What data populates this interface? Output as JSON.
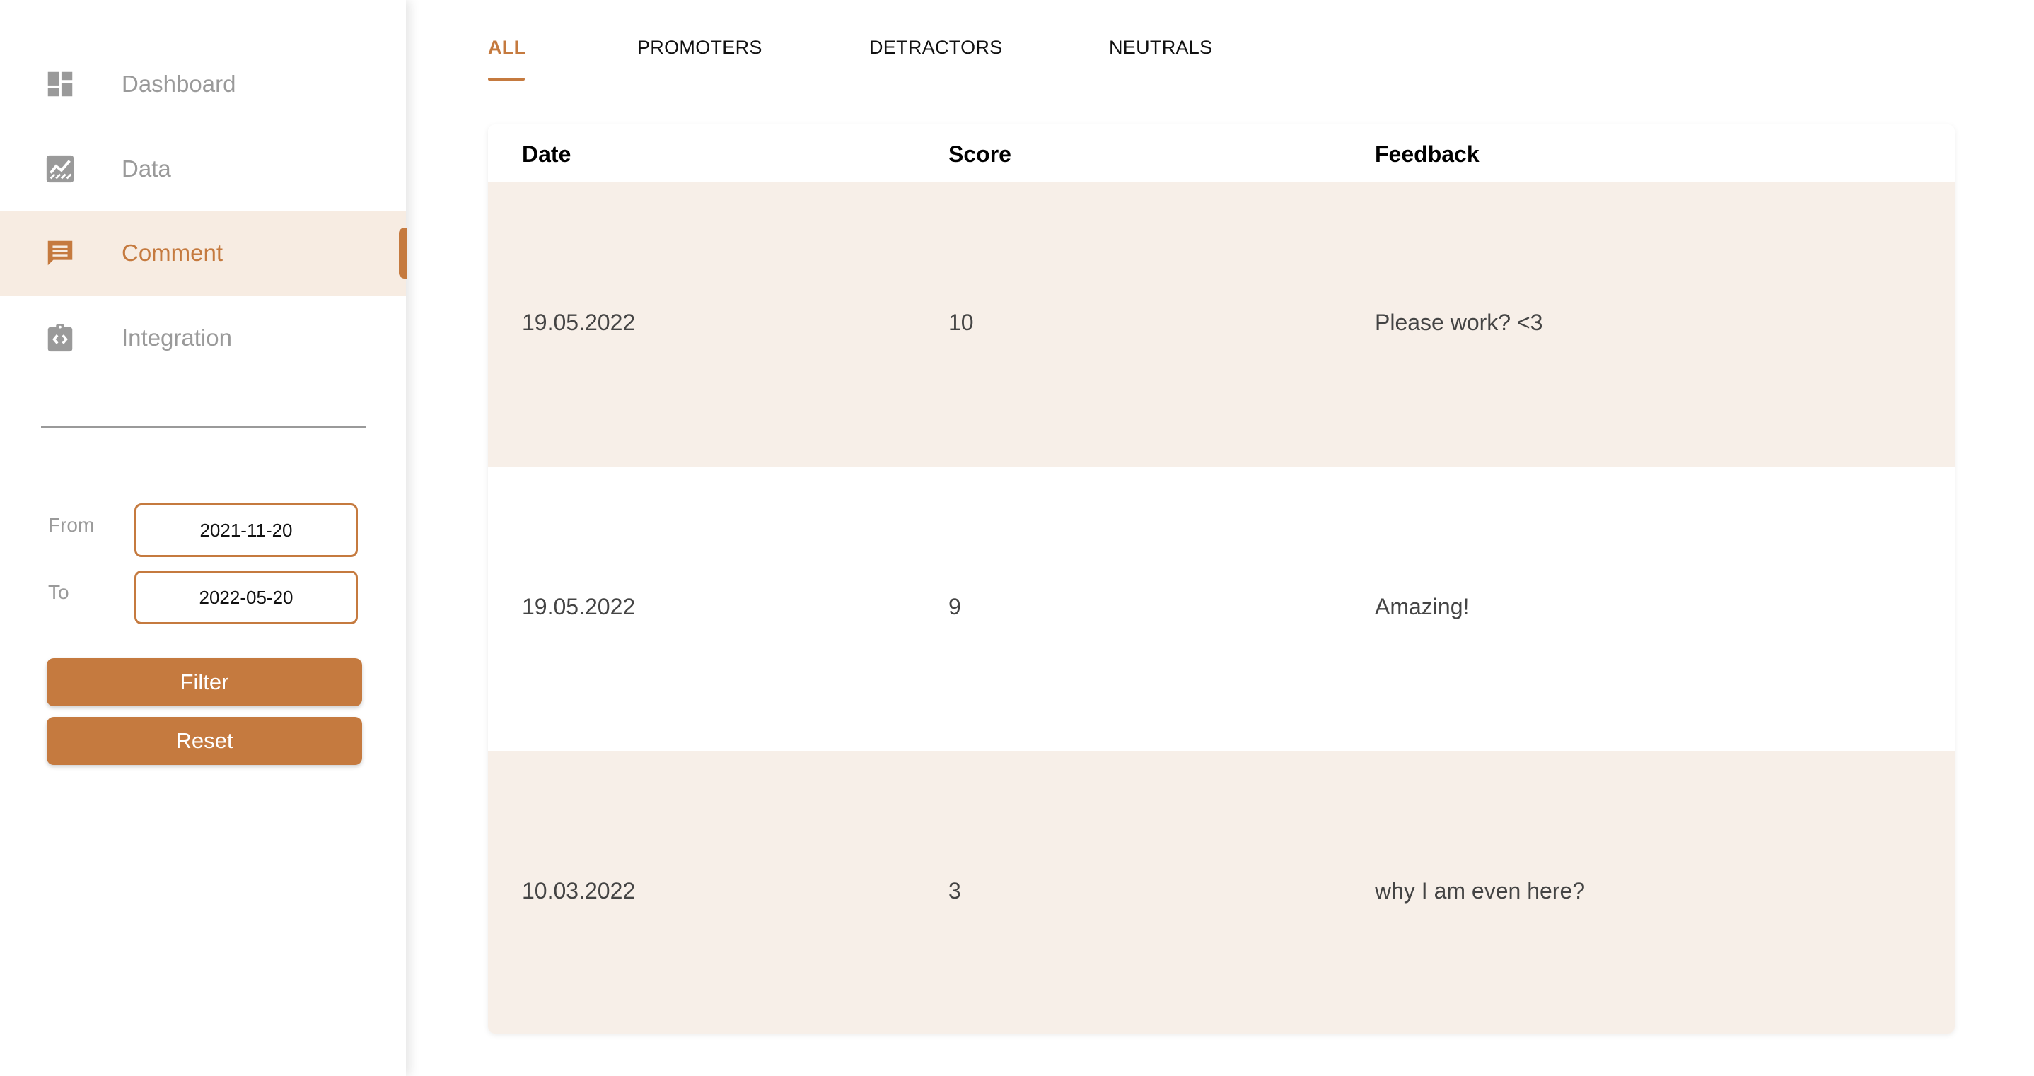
{
  "sidebar": {
    "items": [
      {
        "label": "Dashboard",
        "icon": "dashboard-icon"
      },
      {
        "label": "Data",
        "icon": "chart-icon"
      },
      {
        "label": "Comment",
        "icon": "comment-icon",
        "active": true
      },
      {
        "label": "Integration",
        "icon": "integration-icon"
      }
    ],
    "filter": {
      "from_label": "From",
      "from_value": "2021-11-20",
      "to_label": "To",
      "to_value": "2022-05-20",
      "filter_button": "Filter",
      "reset_button": "Reset"
    }
  },
  "tabs": [
    {
      "label": "ALL",
      "active": true
    },
    {
      "label": "PROMOTERS"
    },
    {
      "label": "DETRACTORS"
    },
    {
      "label": "NEUTRALS"
    }
  ],
  "table": {
    "headers": [
      "Date",
      "Score",
      "Feedback"
    ],
    "rows": [
      {
        "date": "19.05.2022",
        "score": "10",
        "feedback": "Please work? <3"
      },
      {
        "date": "19.05.2022",
        "score": "9",
        "feedback": "Amazing!"
      },
      {
        "date": "10.03.2022",
        "score": "3",
        "feedback": "why I am even here?"
      }
    ]
  },
  "colors": {
    "accent": "#c57a3f",
    "active_bg": "#f7ece2",
    "row_shade": "#f7efe8",
    "muted_text": "#9a9a9a"
  }
}
